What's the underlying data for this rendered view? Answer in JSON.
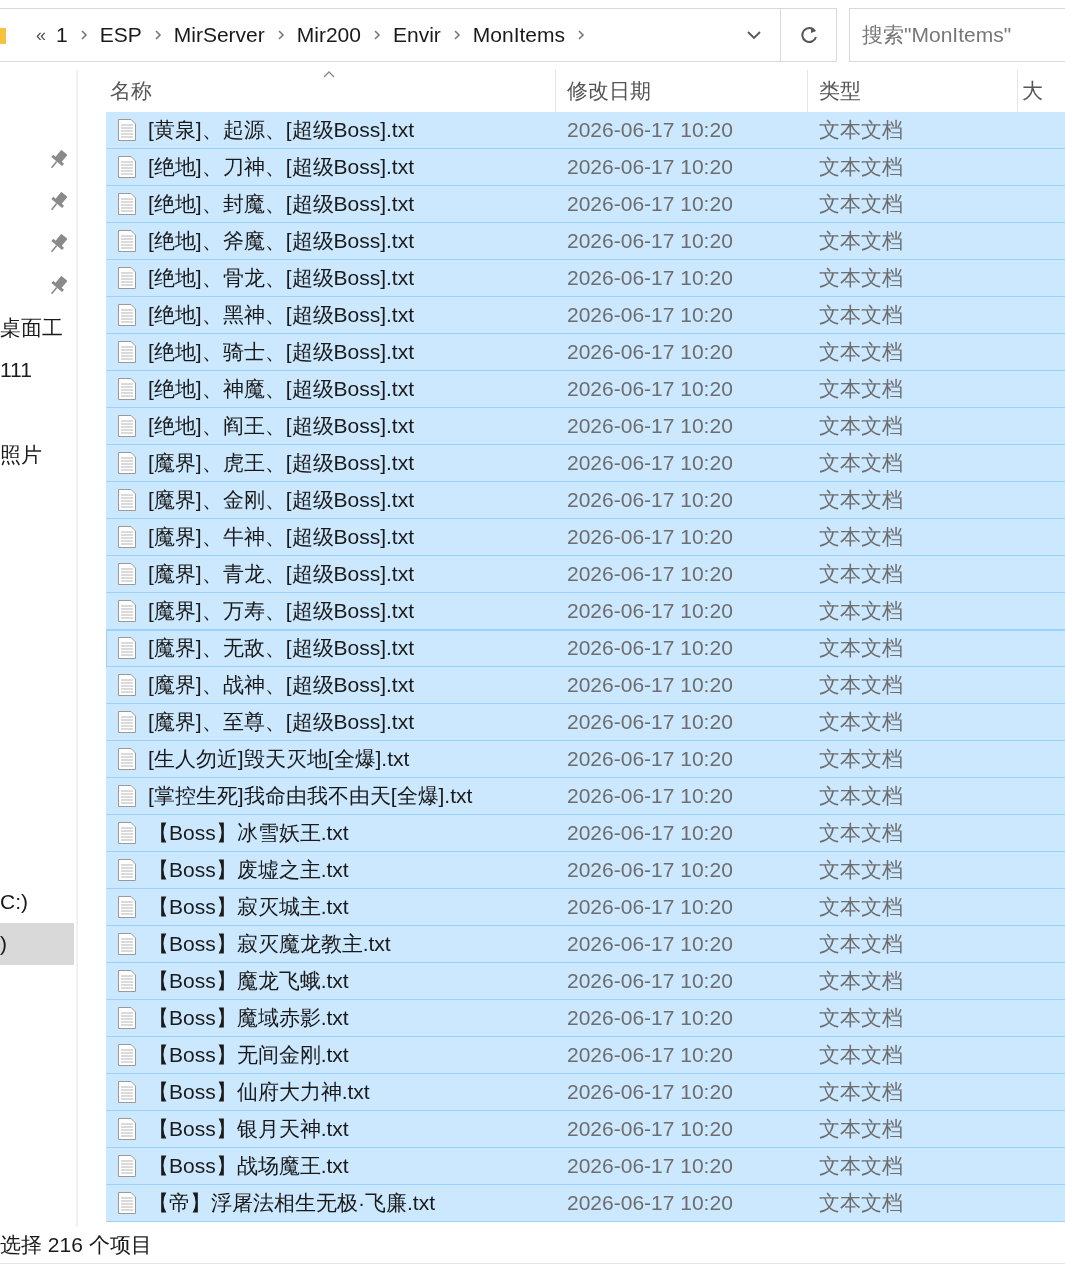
{
  "address_bar": {
    "overflow": "«",
    "path": [
      "1",
      "ESP",
      "MirServer",
      "Mir200",
      "Envir",
      "MonItems"
    ]
  },
  "search": {
    "placeholder": "搜索\"MonItems\""
  },
  "sidebar": {
    "sections": [
      {
        "items": [
          {
            "kind": "pinned",
            "selected": false
          },
          {
            "kind": "pinned",
            "selected": false
          },
          {
            "kind": "pinned",
            "selected": false
          },
          {
            "kind": "pinned",
            "selected": false
          },
          {
            "kind": "folder",
            "label": "桌面工",
            "selected": false
          },
          {
            "kind": "folder",
            "label": "111",
            "selected": false
          }
        ]
      },
      {
        "items": [
          {
            "kind": "folder",
            "label": "照片",
            "selected": false
          }
        ]
      },
      {
        "items": [
          {
            "kind": "drive",
            "label": "C:)",
            "selected": false
          },
          {
            "kind": "drive",
            "label": ")",
            "selected": true
          }
        ]
      }
    ]
  },
  "table": {
    "columns": [
      {
        "label": "名称",
        "sorted": true
      },
      {
        "label": "修改日期",
        "sorted": false
      },
      {
        "label": "类型",
        "sorted": false
      },
      {
        "label": "大",
        "sorted": false
      }
    ],
    "rows": [
      {
        "name": "[黄泉]、起源、[超级Boss].txt",
        "date": "2026-06-17 10:20",
        "type": "文本文档",
        "selected": true,
        "focused": false
      },
      {
        "name": "[绝地]、刀神、[超级Boss].txt",
        "date": "2026-06-17 10:20",
        "type": "文本文档",
        "selected": true,
        "focused": false
      },
      {
        "name": "[绝地]、封魔、[超级Boss].txt",
        "date": "2026-06-17 10:20",
        "type": "文本文档",
        "selected": true,
        "focused": false
      },
      {
        "name": "[绝地]、斧魔、[超级Boss].txt",
        "date": "2026-06-17 10:20",
        "type": "文本文档",
        "selected": true,
        "focused": false
      },
      {
        "name": "[绝地]、骨龙、[超级Boss].txt",
        "date": "2026-06-17 10:20",
        "type": "文本文档",
        "selected": true,
        "focused": false
      },
      {
        "name": "[绝地]、黑神、[超级Boss].txt",
        "date": "2026-06-17 10:20",
        "type": "文本文档",
        "selected": true,
        "focused": false
      },
      {
        "name": "[绝地]、骑士、[超级Boss].txt",
        "date": "2026-06-17 10:20",
        "type": "文本文档",
        "selected": true,
        "focused": false
      },
      {
        "name": "[绝地]、神魔、[超级Boss].txt",
        "date": "2026-06-17 10:20",
        "type": "文本文档",
        "selected": true,
        "focused": false
      },
      {
        "name": "[绝地]、阎王、[超级Boss].txt",
        "date": "2026-06-17 10:20",
        "type": "文本文档",
        "selected": true,
        "focused": false
      },
      {
        "name": "[魔界]、虎王、[超级Boss].txt",
        "date": "2026-06-17 10:20",
        "type": "文本文档",
        "selected": true,
        "focused": false
      },
      {
        "name": "[魔界]、金刚、[超级Boss].txt",
        "date": "2026-06-17 10:20",
        "type": "文本文档",
        "selected": true,
        "focused": false
      },
      {
        "name": "[魔界]、牛神、[超级Boss].txt",
        "date": "2026-06-17 10:20",
        "type": "文本文档",
        "selected": true,
        "focused": false
      },
      {
        "name": "[魔界]、青龙、[超级Boss].txt",
        "date": "2026-06-17 10:20",
        "type": "文本文档",
        "selected": true,
        "focused": false
      },
      {
        "name": "[魔界]、万寿、[超级Boss].txt",
        "date": "2026-06-17 10:20",
        "type": "文本文档",
        "selected": true,
        "focused": false
      },
      {
        "name": "[魔界]、无敌、[超级Boss].txt",
        "date": "2026-06-17 10:20",
        "type": "文本文档",
        "selected": true,
        "focused": true
      },
      {
        "name": "[魔界]、战神、[超级Boss].txt",
        "date": "2026-06-17 10:20",
        "type": "文本文档",
        "selected": true,
        "focused": false
      },
      {
        "name": "[魔界]、至尊、[超级Boss].txt",
        "date": "2026-06-17 10:20",
        "type": "文本文档",
        "selected": true,
        "focused": false
      },
      {
        "name": "[生人勿近]毁天灭地[全爆].txt",
        "date": "2026-06-17 10:20",
        "type": "文本文档",
        "selected": true,
        "focused": false
      },
      {
        "name": "[掌控生死]我命由我不由天[全爆].txt",
        "date": "2026-06-17 10:20",
        "type": "文本文档",
        "selected": true,
        "focused": false
      },
      {
        "name": "【Boss】冰雪妖王.txt",
        "date": "2026-06-17 10:20",
        "type": "文本文档",
        "selected": true,
        "focused": false
      },
      {
        "name": "【Boss】废墟之主.txt",
        "date": "2026-06-17 10:20",
        "type": "文本文档",
        "selected": true,
        "focused": false
      },
      {
        "name": "【Boss】寂灭城主.txt",
        "date": "2026-06-17 10:20",
        "type": "文本文档",
        "selected": true,
        "focused": false
      },
      {
        "name": "【Boss】寂灭魔龙教主.txt",
        "date": "2026-06-17 10:20",
        "type": "文本文档",
        "selected": true,
        "focused": false
      },
      {
        "name": "【Boss】魔龙飞蛾.txt",
        "date": "2026-06-17 10:20",
        "type": "文本文档",
        "selected": true,
        "focused": false
      },
      {
        "name": "【Boss】魔域赤影.txt",
        "date": "2026-06-17 10:20",
        "type": "文本文档",
        "selected": true,
        "focused": false
      },
      {
        "name": "【Boss】无间金刚.txt",
        "date": "2026-06-17 10:20",
        "type": "文本文档",
        "selected": true,
        "focused": false
      },
      {
        "name": "【Boss】仙府大力神.txt",
        "date": "2026-06-17 10:20",
        "type": "文本文档",
        "selected": true,
        "focused": false
      },
      {
        "name": "【Boss】银月天神.txt",
        "date": "2026-06-17 10:20",
        "type": "文本文档",
        "selected": true,
        "focused": false
      },
      {
        "name": "【Boss】战场魔王.txt",
        "date": "2026-06-17 10:20",
        "type": "文本文档",
        "selected": true,
        "focused": false
      },
      {
        "name": "【帝】浮屠法相生无极·飞廉.txt",
        "date": "2026-06-17 10:20",
        "type": "文本文档",
        "selected": true,
        "focused": false
      }
    ]
  },
  "status_bar": {
    "text": "选择 216 个项目"
  }
}
